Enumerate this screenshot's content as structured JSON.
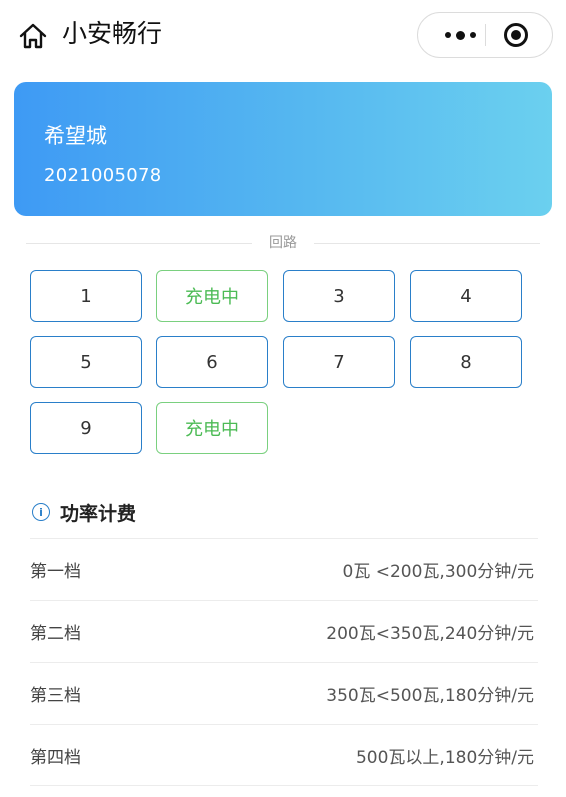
{
  "nav": {
    "title": "小安畅行",
    "icons": {
      "home": "home-icon",
      "more": "more-dots-icon",
      "close": "close-circle-icon"
    }
  },
  "card": {
    "name": "希望城",
    "code": "2021005078",
    "colors": {
      "gradient_start": "#3e9af4",
      "gradient_end": "#6bd0ef"
    }
  },
  "circuit": {
    "label": "回路",
    "cells": [
      {
        "label": "1",
        "status": "idle"
      },
      {
        "label": "充电中",
        "status": "charging"
      },
      {
        "label": "3",
        "status": "idle"
      },
      {
        "label": "4",
        "status": "idle"
      },
      {
        "label": "5",
        "status": "idle"
      },
      {
        "label": "6",
        "status": "idle"
      },
      {
        "label": "7",
        "status": "idle"
      },
      {
        "label": "8",
        "status": "idle"
      },
      {
        "label": "9",
        "status": "idle"
      },
      {
        "label": "充电中",
        "status": "charging"
      }
    ],
    "colors": {
      "idle_border": "#2a7fc9",
      "charging": "#4cbb55"
    }
  },
  "pricing": {
    "title": "功率计费",
    "icon": "info-icon",
    "tiers": [
      {
        "name": "第一档",
        "value": "0瓦 <200瓦,300分钟/元"
      },
      {
        "name": "第二档",
        "value": "200瓦<350瓦,240分钟/元"
      },
      {
        "name": "第三档",
        "value": "350瓦<500瓦,180分钟/元"
      },
      {
        "name": "第四档",
        "value": "500瓦以上,180分钟/元"
      }
    ]
  }
}
